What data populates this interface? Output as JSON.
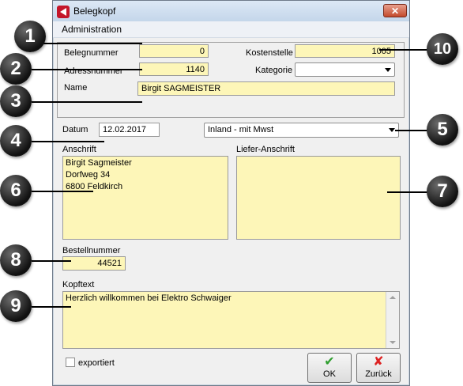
{
  "window": {
    "title": "Belegkopf",
    "close_label": "✕"
  },
  "menu": {
    "administration": "Administration"
  },
  "form": {
    "belegnummer_label": "Belegnummer",
    "belegnummer_value": "0",
    "adressnummer_label": "Adressnummer",
    "adressnummer_value": "1140",
    "name_label": "Name",
    "name_value": "Birgit SAGMEISTER",
    "kostenstelle_label": "Kostenstelle",
    "kostenstelle_value": "1005",
    "kategorie_label": "Kategorie",
    "kategorie_value": "",
    "datum_label": "Datum",
    "datum_value": "12.02.2017",
    "steuer_value": "Inland - mit Mwst",
    "anschrift_label": "Anschrift",
    "anschrift_lines": [
      "Birgit Sagmeister",
      "Dorfweg 34",
      "6800 Feldkirch"
    ],
    "liefer_label": "Liefer-Anschrift",
    "bestellnummer_label": "Bestellnummer",
    "bestellnummer_value": "44521",
    "kopftext_label": "Kopftext",
    "kopftext_value": "Herzlich willkommen bei Elektro Schwaiger",
    "exportiert_label": "exportiert"
  },
  "buttons": {
    "ok_label": "OK",
    "zurueck_label": "Zurück"
  },
  "callouts": [
    "1",
    "2",
    "3",
    "4",
    "5",
    "6",
    "7",
    "8",
    "9",
    "10"
  ],
  "colors": {
    "field_yellow": "#fdf6b8",
    "ok_green": "#2e9e2e",
    "cancel_red": "#d22"
  }
}
